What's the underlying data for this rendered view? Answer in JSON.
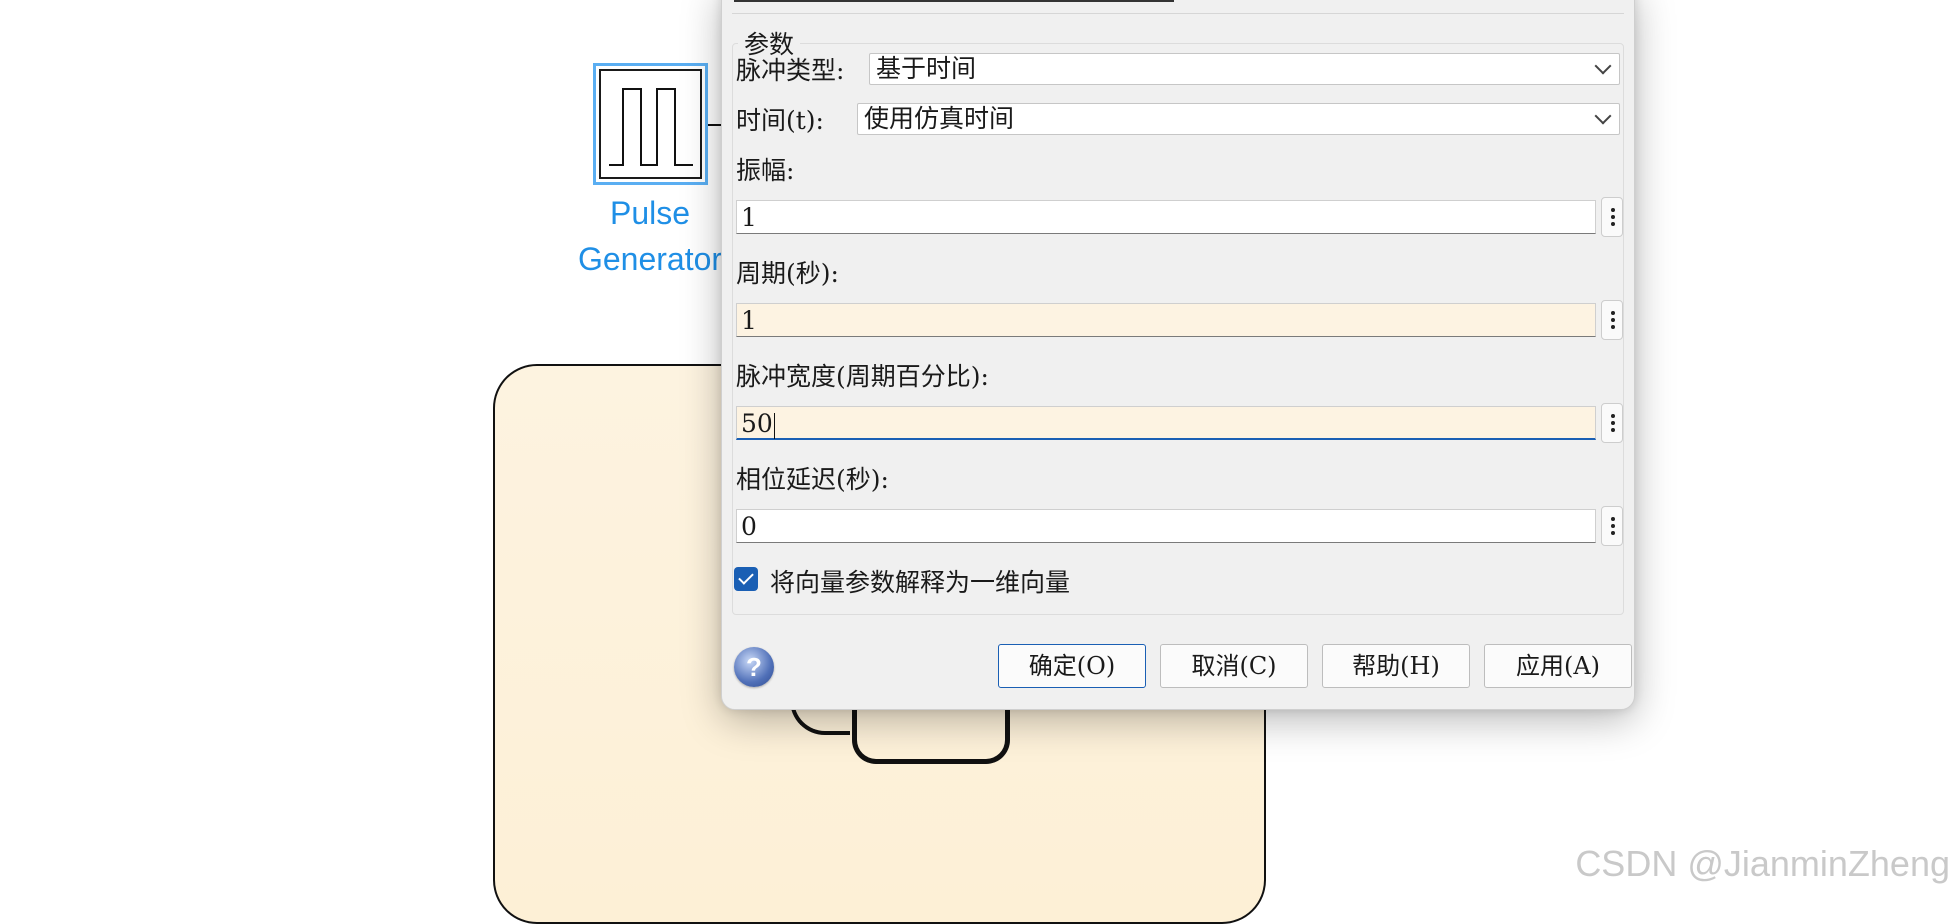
{
  "canvas": {
    "block_label_line1": "Pulse",
    "block_label_line2": "Generator",
    "watermark": "CSDN @JianminZheng"
  },
  "dialog": {
    "group_title": "参数",
    "pulse_type_label": "脉冲类型:",
    "pulse_type_value": "基于时间",
    "time_label": "时间(t):",
    "time_value": "使用仿真时间",
    "amplitude_label": "振幅:",
    "amplitude_value": "1",
    "period_label": "周期(秒):",
    "period_value": "1",
    "pulse_width_label": "脉冲宽度(周期百分比):",
    "pulse_width_value": "50",
    "phase_delay_label": "相位延迟(秒):",
    "phase_delay_value": "0",
    "vector_checkbox_label": "将向量参数解释为一维向量",
    "vector_checkbox_checked": true,
    "buttons": {
      "ok": "确定(O)",
      "cancel": "取消(C)",
      "help": "帮助(H)",
      "apply": "应用(A)"
    }
  },
  "colors": {
    "selection_blue": "#1f8fe6",
    "highlight_field": "#fdf3e2",
    "focus_accent": "#1a5fb4",
    "subsystem_fill": "#fdf3e0"
  }
}
